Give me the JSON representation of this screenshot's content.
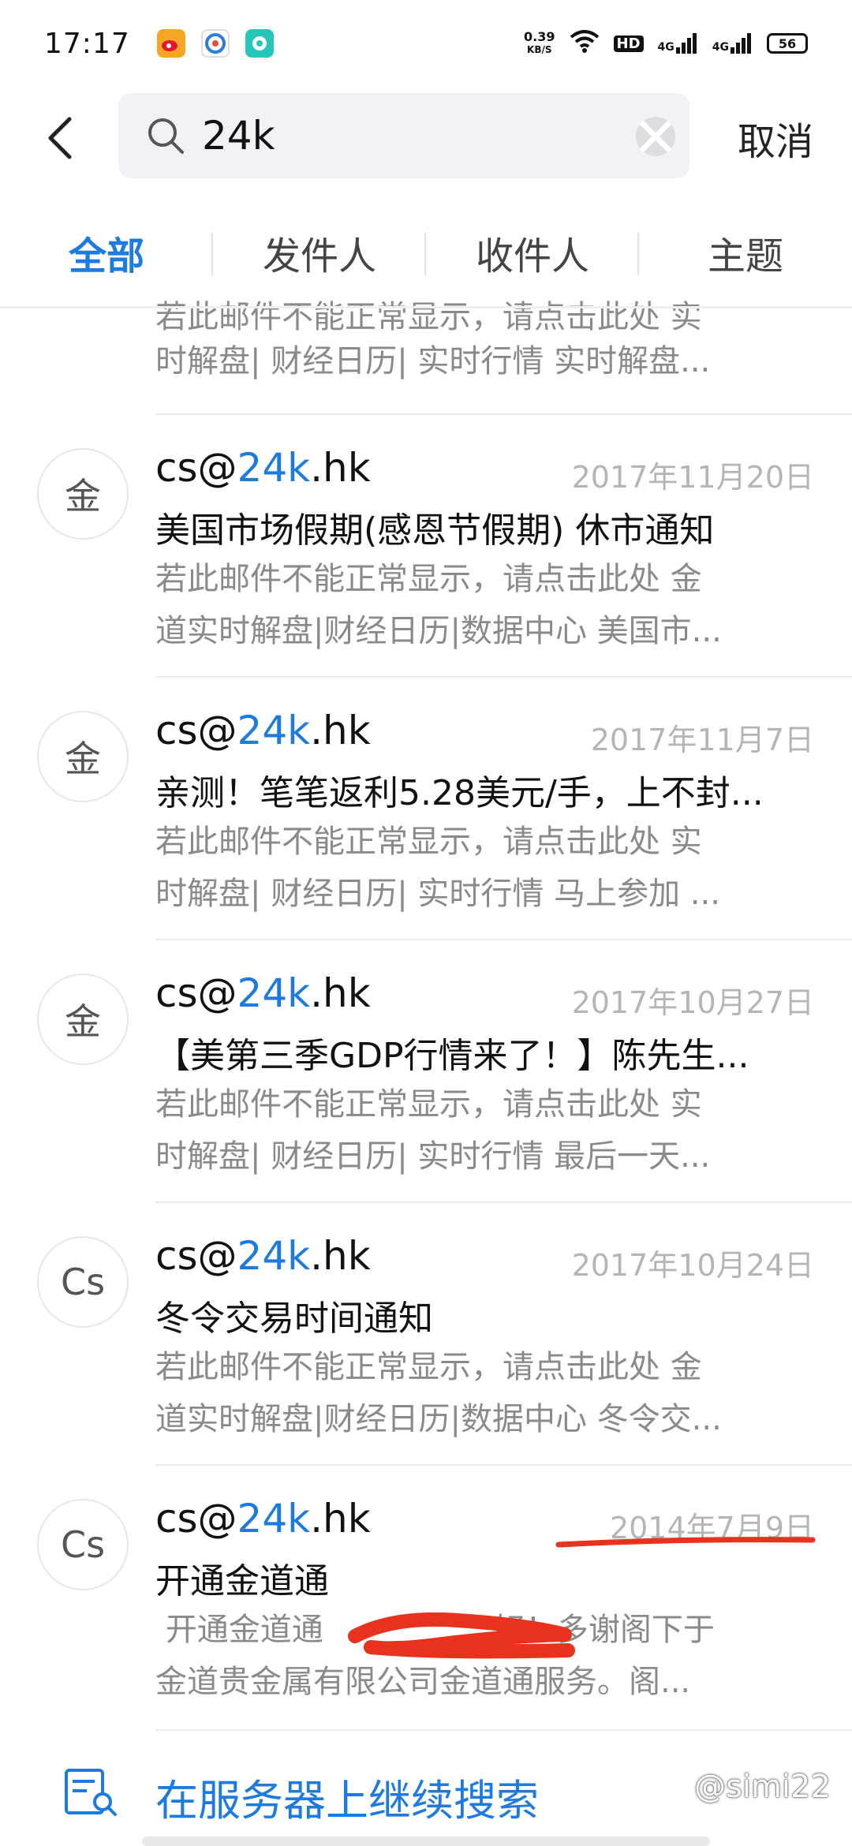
{
  "status_bar": {
    "time": "17:17",
    "speed_value": "0.39",
    "speed_unit": "KB/S",
    "hd_label": "HD",
    "signal_1": "4G",
    "signal_2": "4G",
    "battery": "56"
  },
  "search": {
    "query": "24k",
    "cancel_label": "取消"
  },
  "tabs": [
    {
      "label": "全部",
      "active": true
    },
    {
      "label": "发件人",
      "active": false
    },
    {
      "label": "收件人",
      "active": false
    },
    {
      "label": "主题",
      "active": false
    }
  ],
  "partial_item": {
    "preview_line_1": "若此邮件不能正常显示，请点击此处 实",
    "preview_line_2": "时解盘| 财经日历| 实时行情 实时解盘..."
  },
  "emails": [
    {
      "avatar": "金",
      "sender_prefix": "cs@",
      "sender_highlight": "24k",
      "sender_suffix": ".hk",
      "date": "2017年11月20日",
      "subject": "美国市场假期(感恩节假期) 休市通知",
      "preview_line_1": " 若此邮件不能正常显示，请点击此处 金",
      "preview_line_2": "道实时解盘|财经日历|数据中心 美国市..."
    },
    {
      "avatar": "金",
      "sender_prefix": "cs@",
      "sender_highlight": "24k",
      "sender_suffix": ".hk",
      "date": "2017年11月7日",
      "subject": "亲测！笔笔返利5.28美元/手，上不封...",
      "preview_line_1": " 若此邮件不能正常显示，请点击此处 实",
      "preview_line_2": "时解盘| 财经日历| 实时行情 马上参加 ..."
    },
    {
      "avatar": "金",
      "sender_prefix": "cs@",
      "sender_highlight": "24k",
      "sender_suffix": ".hk",
      "date": "2017年10月27日",
      "subject": "【美第三季GDP行情来了！】陈先生...",
      "preview_line_1": " 若此邮件不能正常显示，请点击此处 实",
      "preview_line_2": "时解盘| 财经日历| 实时行情 最后一天..."
    },
    {
      "avatar": "Cs",
      "sender_prefix": "cs@",
      "sender_highlight": "24k",
      "sender_suffix": ".hk",
      "date": "2017年10月24日",
      "subject": "冬令交易时间通知",
      "preview_line_1": " 若此邮件不能正常显示，请点击此处 金",
      "preview_line_2": "道实时解盘|财经日历|数据中心 冬令交..."
    },
    {
      "avatar": "Cs",
      "sender_prefix": "cs@",
      "sender_highlight": "24k",
      "sender_suffix": ".hk",
      "date": "2014年7月9日",
      "subject": "开通金道通",
      "preview_line_1": " 开通金道通                 好！多谢阁下于",
      "preview_line_2": "金道贵金属有限公司金道通服务。阁..."
    }
  ],
  "server_search_label": "在服务器上继续搜索",
  "watermark": "@simi22",
  "colors": {
    "accent": "#1d7ae0",
    "annotation_red": "#e8321e"
  }
}
